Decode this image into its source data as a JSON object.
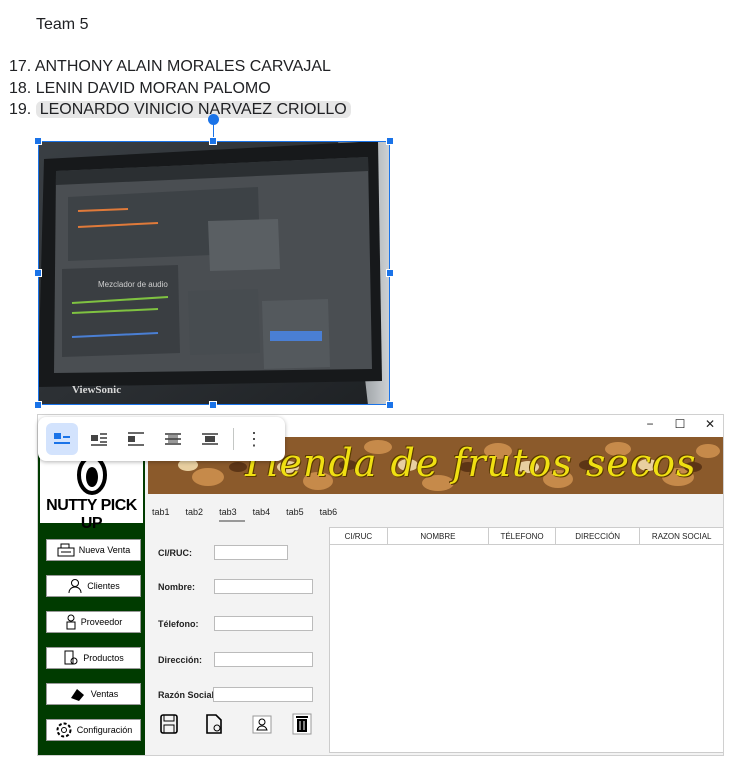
{
  "document": {
    "heading": "Team 5",
    "members": [
      {
        "number": "17.",
        "name": "ANTHONY ALAIN MORALES CARVAJAL"
      },
      {
        "number": "18.",
        "name": "LENIN DAVID MORAN PALOMO"
      },
      {
        "number": "19.",
        "name": "LEONARDO VINICIO NARVAEZ CRIOLLO"
      }
    ],
    "photo_text": {
      "panel_title": "Mezclador de audio",
      "brand": "ViewSonic"
    }
  },
  "image_toolbar": {
    "icons": [
      "inline-wrap-icon",
      "wrap-text-icon",
      "break-text-icon",
      "behind-text-icon",
      "in-front-of-text-icon",
      "more-options-icon"
    ]
  },
  "app": {
    "window_buttons": [
      "−",
      "☐",
      "✕"
    ],
    "logo_text": "NUTTY PICK UP",
    "banner_title": "Tienda de frutos secos",
    "sidebar": [
      {
        "label": "Nueva Venta",
        "icon": "cash-register-icon"
      },
      {
        "label": "Clientes",
        "icon": "user-icon"
      },
      {
        "label": "Proveedor",
        "icon": "supplier-icon"
      },
      {
        "label": "Productos",
        "icon": "products-icon"
      },
      {
        "label": "Ventas",
        "icon": "sales-icon"
      },
      {
        "label": "Configuración",
        "icon": "gear-icon"
      }
    ],
    "tabs": [
      "tab1",
      "tab2",
      "tab3",
      "tab4",
      "tab5",
      "tab6"
    ],
    "active_tab": "tab3",
    "form": {
      "ci_ruc_label": "CI/RUC:",
      "nombre_label": "Nombre:",
      "telefono_label": "Télefono:",
      "direccion_label": "Dirección:",
      "razon_label": "Razón Social:"
    },
    "table_columns": [
      "CI/RUC",
      "NOMBRE",
      "TÉLEFONO",
      "DIRECCIÓN",
      "RAZON SOCIAL"
    ],
    "action_icons": [
      "save-icon",
      "edit-document-icon",
      "user-edit-icon",
      "trash-icon"
    ],
    "colors": {
      "sidebar": "#003b00",
      "banner_text": "#f0e012",
      "selection": "#1a73e8"
    }
  }
}
